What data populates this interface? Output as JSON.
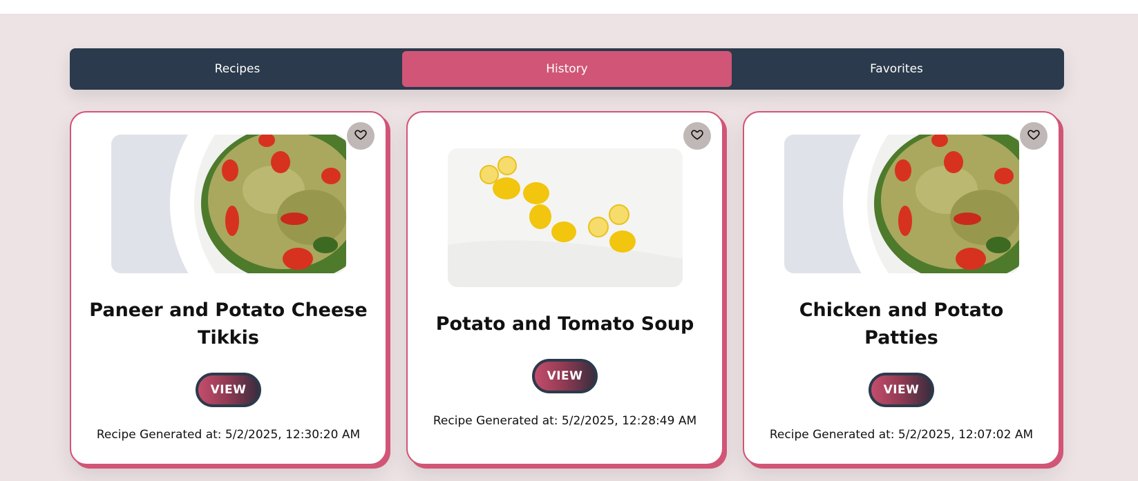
{
  "tabs": [
    {
      "label": "Recipes",
      "active": false
    },
    {
      "label": "History",
      "active": true
    },
    {
      "label": "Favorites",
      "active": false
    }
  ],
  "colors": {
    "accent": "#d15576",
    "nav": "#2b3a4c",
    "background": "#ede3e5"
  },
  "cards": [
    {
      "title": "Paneer and Potato Cheese Tikkis",
      "button": "VIEW",
      "meta": "Recipe Generated at: 5/2/2025, 12:30:20 AM",
      "image": "pasta-salad",
      "favorite_icon": "heart-outline-icon"
    },
    {
      "title": "Potato and Tomato Soup",
      "button": "VIEW",
      "meta": "Recipe Generated at: 5/2/2025, 12:28:49 AM",
      "image": "lemons",
      "favorite_icon": "heart-outline-icon"
    },
    {
      "title": "Chicken and Potato Patties",
      "button": "VIEW",
      "meta": "Recipe Generated at: 5/2/2025, 12:07:02 AM",
      "image": "pasta-salad",
      "favorite_icon": "heart-outline-icon"
    }
  ]
}
